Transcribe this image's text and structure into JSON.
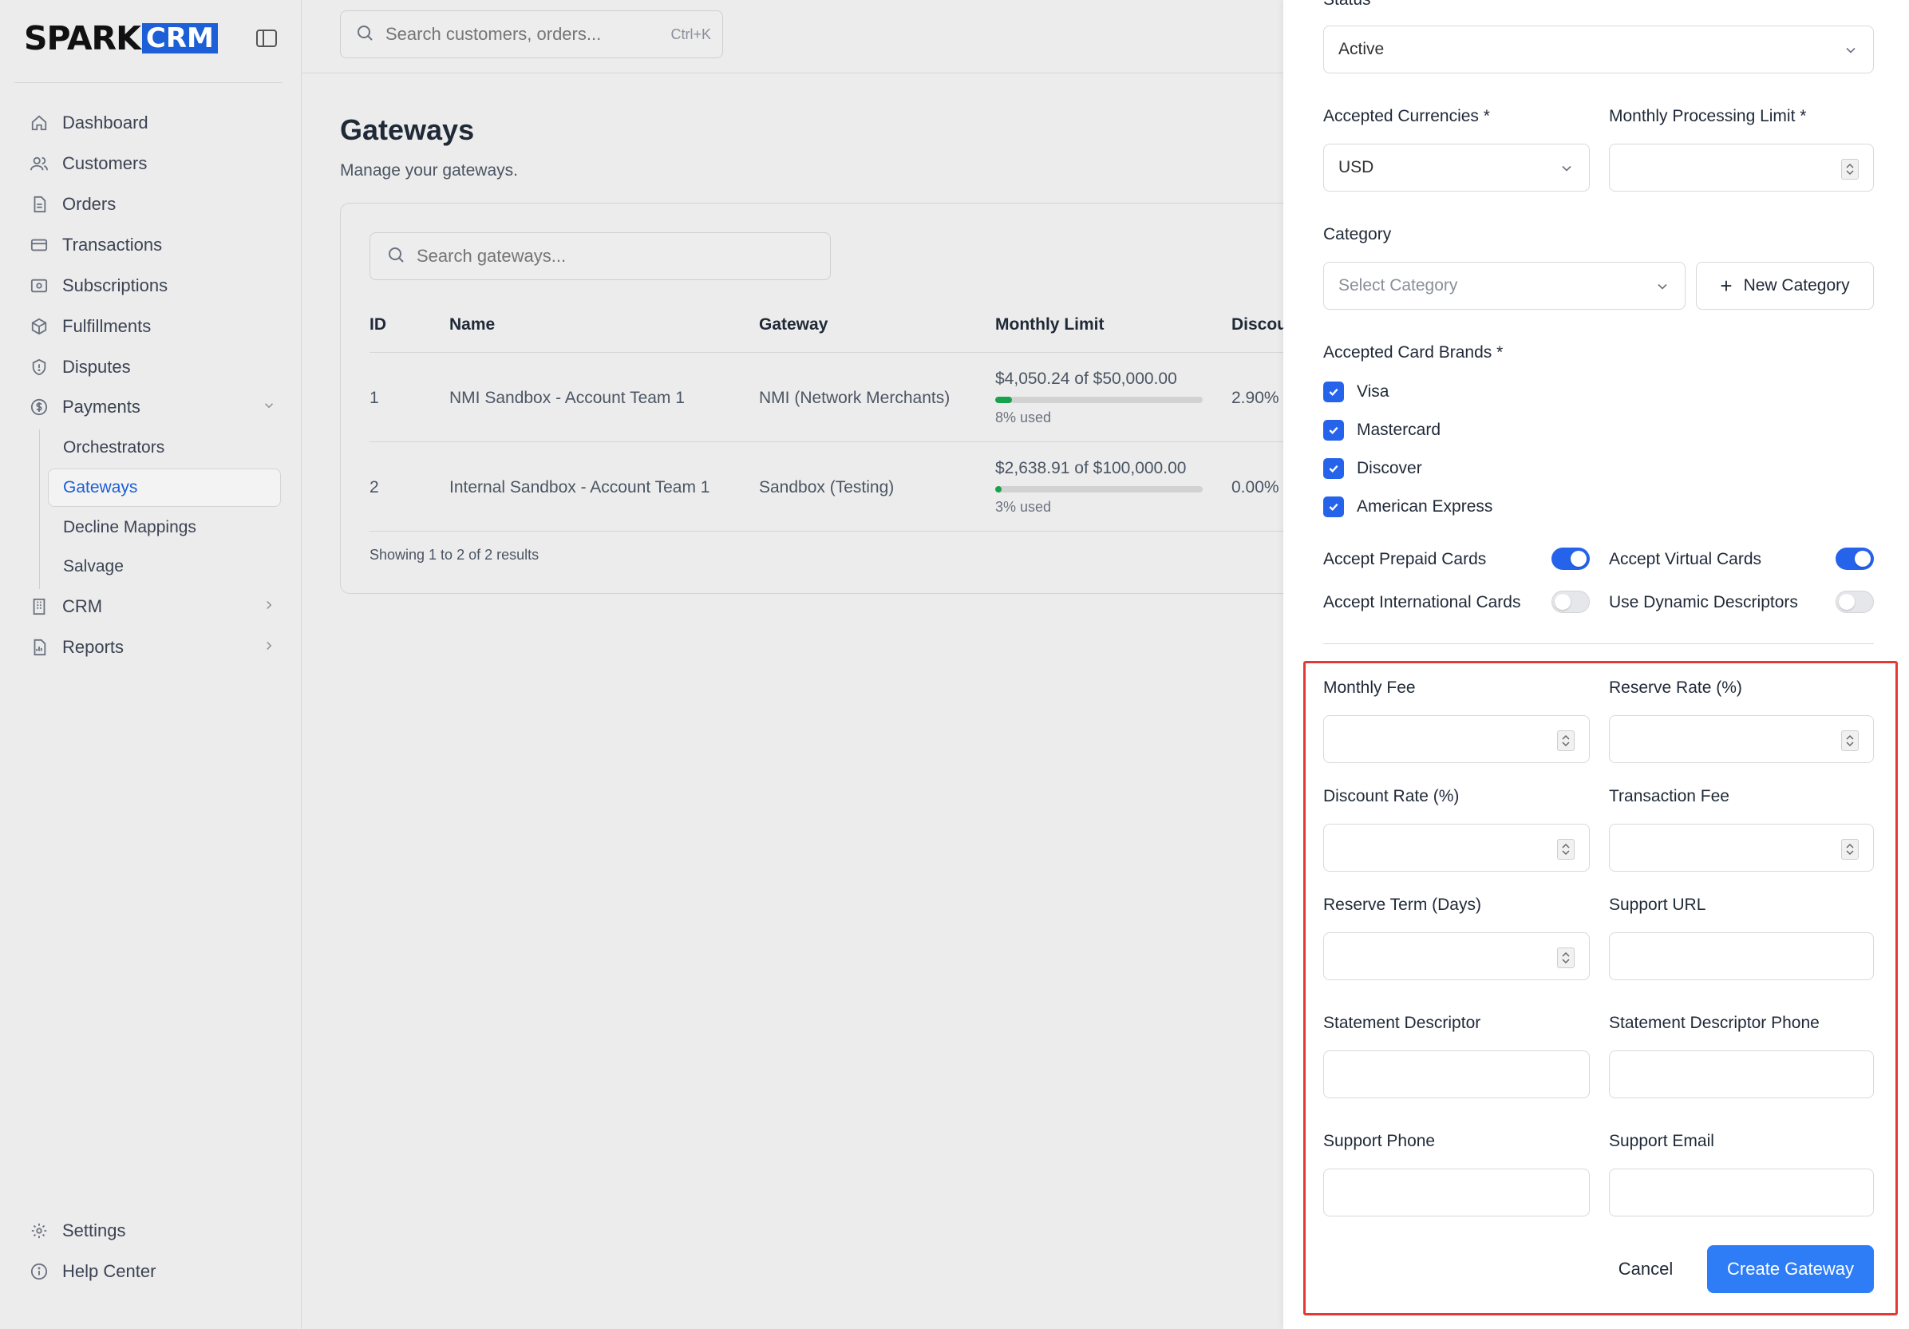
{
  "sidebar": {
    "logo_left": "SPARK",
    "logo_right": "CRM",
    "items": [
      {
        "label": "Dashboard"
      },
      {
        "label": "Customers"
      },
      {
        "label": "Orders"
      },
      {
        "label": "Transactions"
      },
      {
        "label": "Subscriptions"
      },
      {
        "label": "Fulfillments"
      },
      {
        "label": "Disputes"
      },
      {
        "label": "Payments"
      }
    ],
    "payments_sub": [
      {
        "label": "Orchestrators"
      },
      {
        "label": "Gateways"
      },
      {
        "label": "Decline Mappings"
      },
      {
        "label": "Salvage"
      }
    ],
    "crm": "CRM",
    "reports": "Reports",
    "settings": "Settings",
    "help": "Help Center"
  },
  "topbar": {
    "search_placeholder": "Search customers, orders...",
    "shortcut": "Ctrl+K"
  },
  "main": {
    "title": "Gateways",
    "subtitle": "Manage your gateways.",
    "search_placeholder": "Search gateways...",
    "columns": [
      "ID",
      "Name",
      "Gateway",
      "Monthly Limit",
      "Discou"
    ],
    "rows": [
      {
        "id": "1",
        "name": "NMI Sandbox - Account Team 1",
        "gateway": "NMI (Network Merchants)",
        "limit_used": "$4,050.24",
        "limit_of": "of",
        "limit_total": "$50,000.00",
        "used_pct": 8,
        "used_label": "8% used",
        "discount": "2.90%"
      },
      {
        "id": "2",
        "name": "Internal Sandbox - Account Team 1",
        "gateway": "Sandbox (Testing)",
        "limit_used": "$2,638.91",
        "limit_of": "of",
        "limit_total": "$100,000.00",
        "used_pct": 3,
        "used_label": "3% used",
        "discount": "0.00%"
      }
    ],
    "footer": "Showing 1 to 2 of 2 results"
  },
  "drawer": {
    "status_label": "Status *",
    "status_value": "Active",
    "currencies_label": "Accepted Currencies *",
    "currencies_value": "USD",
    "monthly_limit_label": "Monthly Processing Limit *",
    "category_label": "Category",
    "category_placeholder": "Select Category",
    "new_category": "New Category",
    "card_brands_label": "Accepted Card Brands *",
    "card_brands": [
      "Visa",
      "Mastercard",
      "Discover",
      "American Express"
    ],
    "accept_prepaid": "Accept Prepaid Cards",
    "accept_virtual": "Accept Virtual Cards",
    "accept_international": "Accept International Cards",
    "dynamic_descriptors": "Use Dynamic Descriptors",
    "monthly_fee": "Monthly Fee",
    "reserve_rate": "Reserve Rate (%)",
    "discount_rate": "Discount Rate (%)",
    "transaction_fee": "Transaction Fee",
    "reserve_term": "Reserve Term (Days)",
    "support_url": "Support URL",
    "statement_descriptor": "Statement Descriptor",
    "statement_descriptor_phone": "Statement Descriptor Phone",
    "support_phone": "Support Phone",
    "support_email": "Support Email",
    "cancel": "Cancel",
    "create": "Create Gateway"
  },
  "colors": {
    "accent": "#2563eb",
    "highlight": "#e53935",
    "progress": "#16a34a"
  }
}
